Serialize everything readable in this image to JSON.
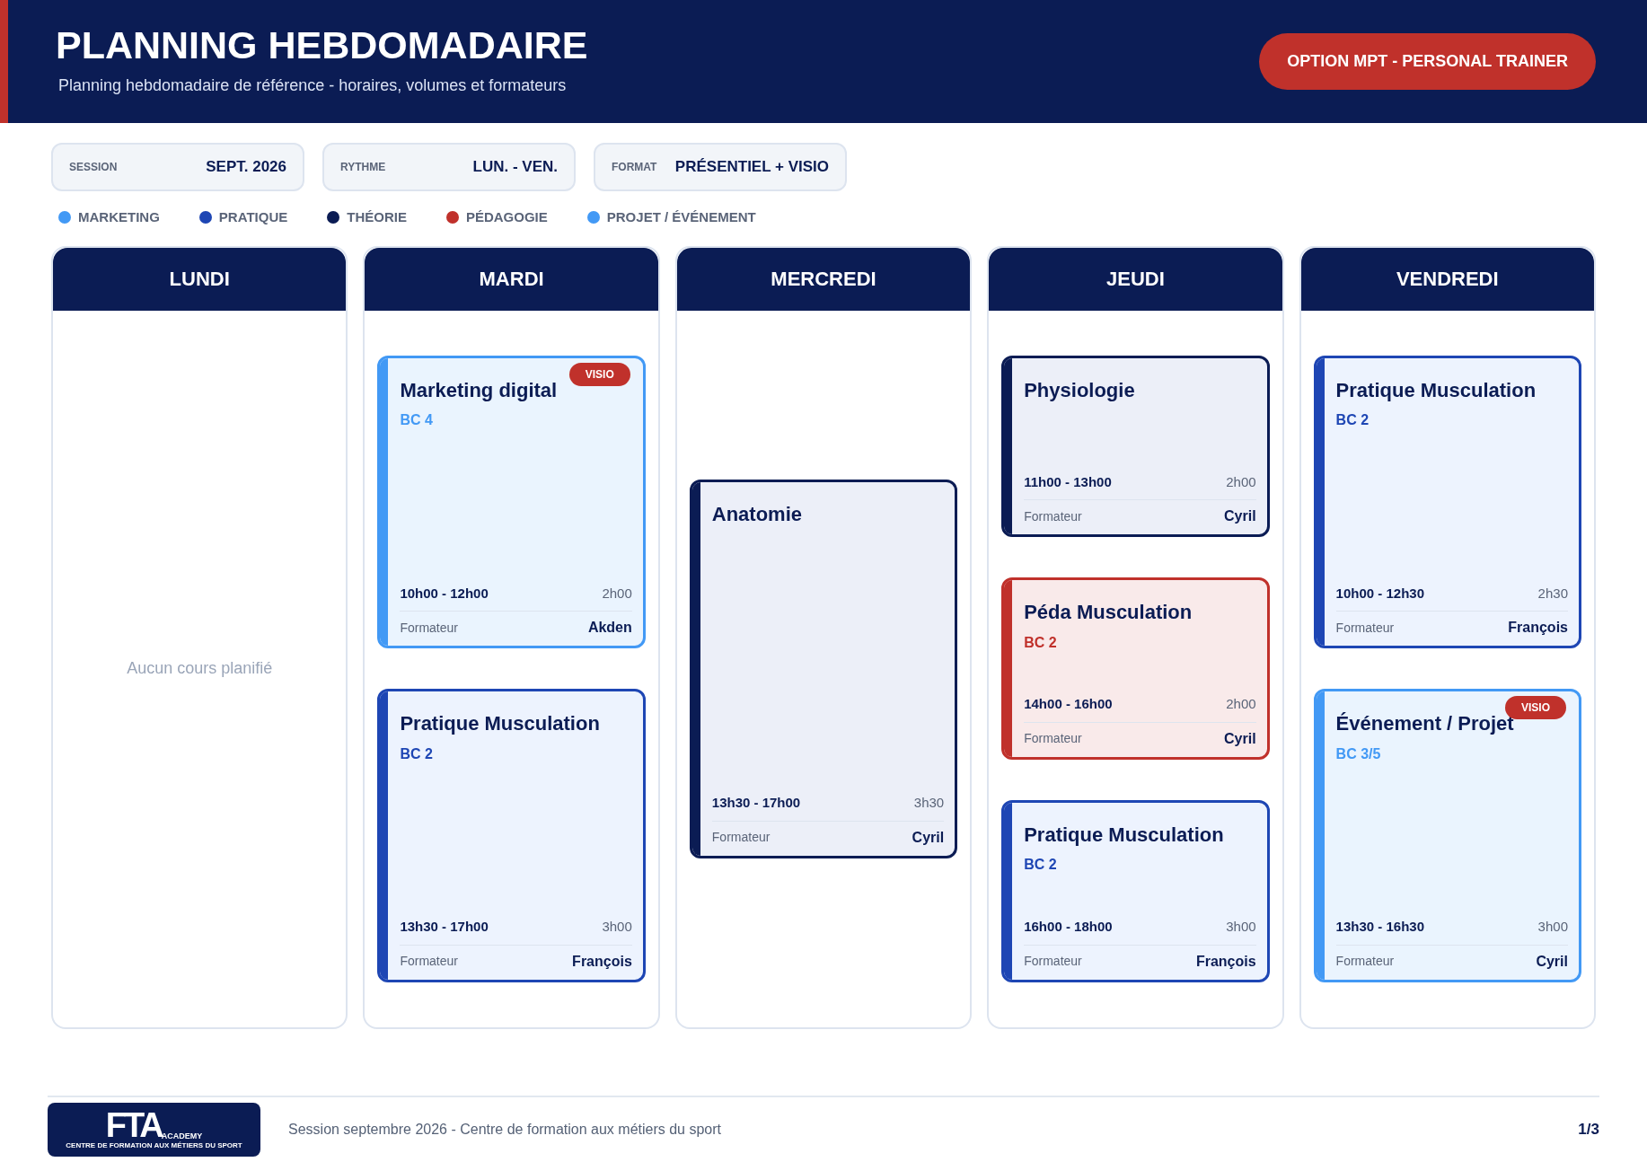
{
  "header": {
    "title": "PLANNING HEBDOMADAIRE",
    "subtitle": "Planning hebdomadaire de référence - horaires, volumes et formateurs",
    "option": "OPTION MPT - PERSONAL TRAINER"
  },
  "info": [
    {
      "label": "SESSION",
      "value": "SEPT. 2026"
    },
    {
      "label": "RYTHME",
      "value": "LUN. - VEN."
    },
    {
      "label": "FORMAT",
      "value": "PRÉSENTIEL + VISIO"
    }
  ],
  "legend": [
    {
      "label": "MARKETING",
      "color": "#4299f5"
    },
    {
      "label": "PRATIQUE",
      "color": "#1e46b4"
    },
    {
      "label": "THÉORIE",
      "color": "#0b1c54"
    },
    {
      "label": "PÉDAGOGIE",
      "color": "#c0312b"
    },
    {
      "label": "PROJET / ÉVÉNEMENT",
      "color": "#4299f5"
    }
  ],
  "days": [
    {
      "name": "LUNDI",
      "empty": "Aucun cours planifié"
    },
    {
      "name": "MARDI",
      "courses": [
        {
          "title": "Marketing digital",
          "code": "BC 4",
          "color": "#4299f5",
          "badge": "VISIO",
          "time": "10h00 - 12h00",
          "duration": "2h00",
          "trainer_label": "Formateur",
          "trainer": "Akden"
        },
        {
          "title": "Pratique Musculation",
          "code": "BC 2",
          "color": "#1e46b4",
          "time": "13h30 - 17h00",
          "duration": "3h00",
          "trainer_label": "Formateur",
          "trainer": "François"
        }
      ]
    },
    {
      "name": "MERCREDI",
      "courses": [
        {
          "title": "Anatomie",
          "color": "#0b1c54",
          "time": "13h30 - 17h00",
          "duration": "3h30",
          "trainer_label": "Formateur",
          "trainer": "Cyril"
        }
      ]
    },
    {
      "name": "JEUDI",
      "courses": [
        {
          "title": "Physiologie",
          "color": "#0b1c54",
          "time": "11h00 - 13h00",
          "duration": "2h00",
          "trainer_label": "Formateur",
          "trainer": "Cyril"
        },
        {
          "title": "Péda Musculation",
          "code": "BC 2",
          "color": "#c0312b",
          "time": "14h00 - 16h00",
          "duration": "2h00",
          "trainer_label": "Formateur",
          "trainer": "Cyril"
        },
        {
          "title": "Pratique Musculation",
          "code": "BC 2",
          "color": "#1e46b4",
          "time": "16h00 - 18h00",
          "duration": "3h00",
          "trainer_label": "Formateur",
          "trainer": "François"
        }
      ]
    },
    {
      "name": "VENDREDI",
      "courses": [
        {
          "title": "Pratique Musculation",
          "code": "BC 2",
          "color": "#1e46b4",
          "time": "10h00 - 12h30",
          "duration": "2h30",
          "trainer_label": "Formateur",
          "trainer": "François"
        },
        {
          "title": "Événement / Projet",
          "code": "BC 3/5",
          "color": "#4299f5",
          "badge": "VISIO",
          "time": "13h30 - 16h30",
          "duration": "3h00",
          "trainer_label": "Formateur",
          "trainer": "Cyril"
        }
      ]
    }
  ],
  "footer": {
    "logo": {
      "letters": "FTA",
      "suffix": "ACADEMY",
      "tagline": "CENTRE DE FORMATION AUX MÉTIERS DU SPORT"
    },
    "text": "Session septembre 2026 - Centre de formation aux métiers du sport",
    "page": "1/3"
  }
}
